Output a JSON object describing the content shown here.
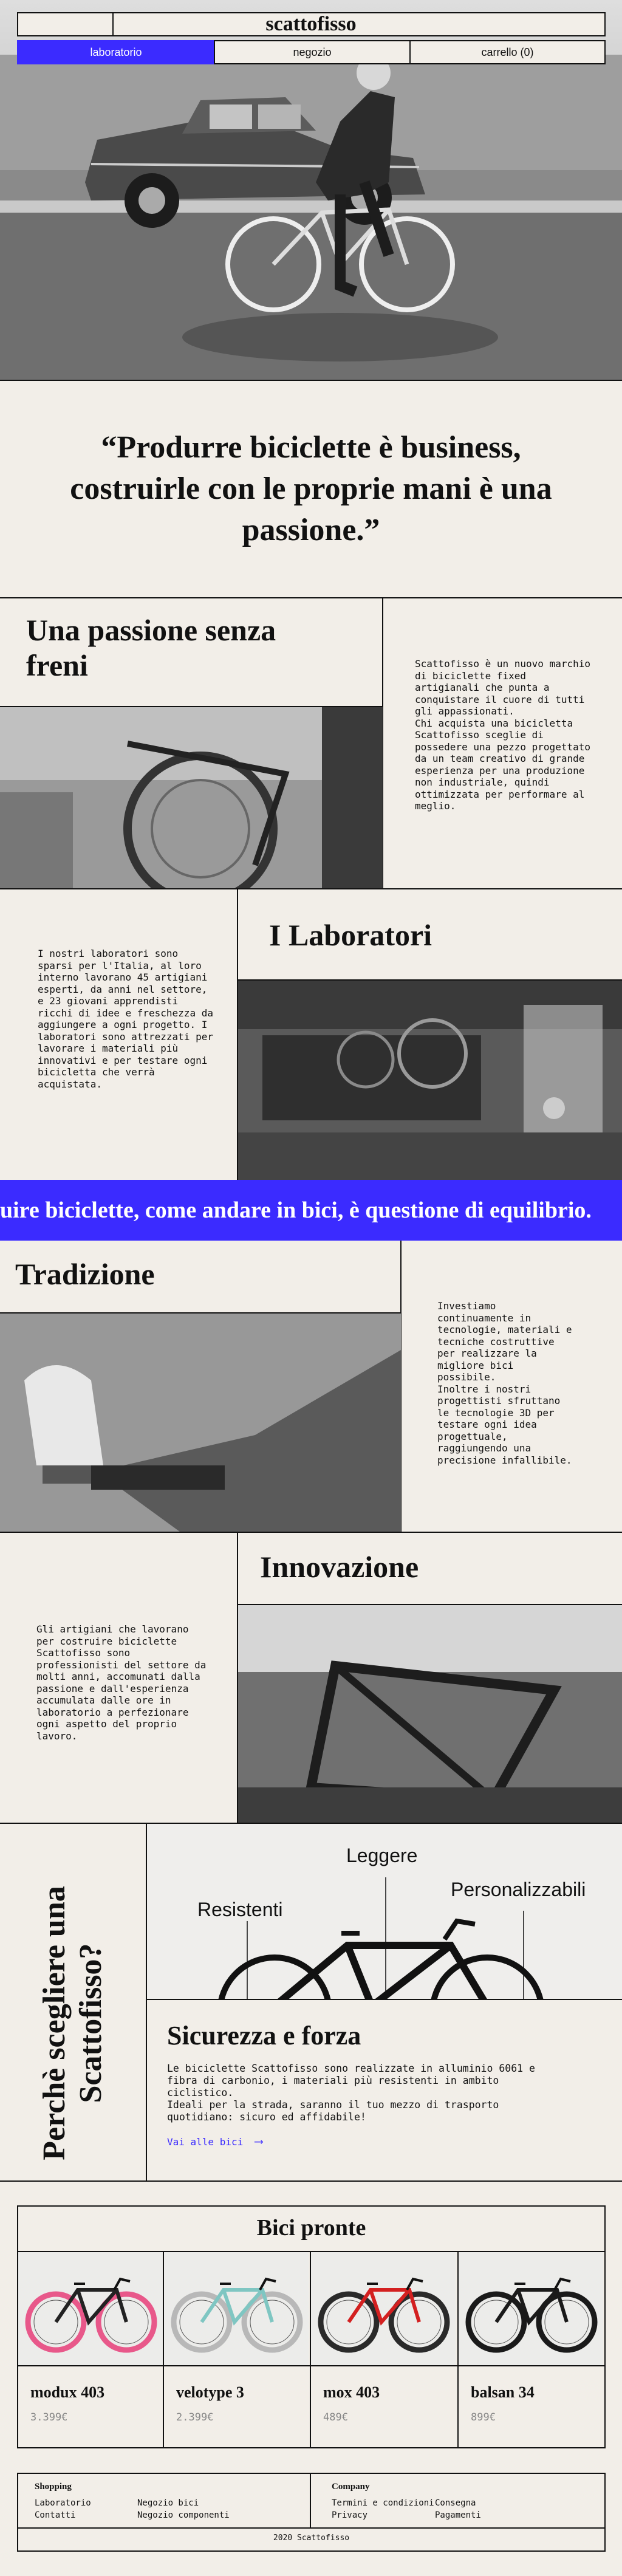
{
  "header": {
    "brand": "scattofisso",
    "nav": [
      {
        "label": "laboratorio"
      },
      {
        "label": "negozio"
      },
      {
        "label": "carrello (0)"
      }
    ]
  },
  "quote": "“Produrre biciclette è business, costruirle con le proprie mani è una passione.”",
  "passion": {
    "title": "Una passione senza freni",
    "text": "Scattofisso è un nuovo marchio di biciclette fixed artigianali che punta a conquistare il cuore di tutti gli appassionati.\nChi acquista una bicicletta Scattofisso sceglie di possedere una pezzo progettato da un team creativo di grande esperienza per una produzione non industriale, quindi ottimizzata per performare al meglio."
  },
  "labs": {
    "title": "I Laboratori",
    "text": "I nostri laboratori sono sparsi per l'Italia, al loro interno lavorano 45 artigiani esperti, da anni nel settore, e 23 giovani apprendisti ricchi di idee e freschezza da aggiungere a ogni progetto. I laboratori sono attrezzati per lavorare i materiali più innovativi e per testare ogni bicicletta che verrà acquistata."
  },
  "banner": "uire biciclette, come andare in bici, è questione di equilibrio.",
  "tradition": {
    "title": "Tradizione",
    "text": "Investiamo continuamente in tecnologie, materiali e tecniche costruttive per realizzare la migliore bici possibile.\nInoltre i nostri progettisti sfruttano le tecnologie 3D per testare ogni idea progettuale, raggiungendo una precisione infallibile."
  },
  "innovation": {
    "title": "Innovazione",
    "text": "Gli artigiani che lavorano per costruire biciclette Scattofisso sono professionisti del settore da molti anni, accomunati dalla passione e dall'esperienza accumulata dalle ore in laboratorio a perfezionare ogni aspetto del proprio lavoro."
  },
  "why": {
    "vertical": "Perchè scegliere una Scattofisso?",
    "labels": {
      "left": "Resistenti",
      "middle": "Leggere",
      "right": "Personalizzabili"
    },
    "title": "Sicurezza e forza",
    "text": "Le biciclette Scattofisso sono realizzate in alluminio 6061 e fibra di carbonio, i materiali più resistenti in ambito ciclistico.\nIdeali per la strada, saranno il tuo mezzo di trasporto quotidiano: sicuro ed affidabile!",
    "link": "Vai alle bici",
    "arrow": "⟶"
  },
  "ready": {
    "title": "Bici pronte",
    "bikes": [
      {
        "name": "modux 403",
        "price": "3.399€",
        "rim": "#e8588a",
        "frame": "#222222"
      },
      {
        "name": "velotype 3",
        "price": "2.399€",
        "rim": "#b8b8b8",
        "frame": "#7fc6c2"
      },
      {
        "name": "mox 403",
        "price": "489€",
        "rim": "#2a2a2a",
        "frame": "#d32020"
      },
      {
        "name": "balsan 34",
        "price": "899€",
        "rim": "#1a1a1a",
        "frame": "#1a1a1a"
      }
    ]
  },
  "footer": {
    "shopping_title": "Shopping",
    "shopping_col1": [
      "Laboratorio",
      "Contatti"
    ],
    "shopping_col2": [
      "Negozio bici",
      "Negozio componenti"
    ],
    "company_title": "Company",
    "company_col1": [
      "Termini e condizioni",
      "Privacy"
    ],
    "company_col2": [
      "Consegna",
      "Pagamenti"
    ],
    "copyright": "2020 Scattofisso"
  },
  "colors": {
    "accent": "#3b2bff",
    "background": "#f2eee8"
  }
}
